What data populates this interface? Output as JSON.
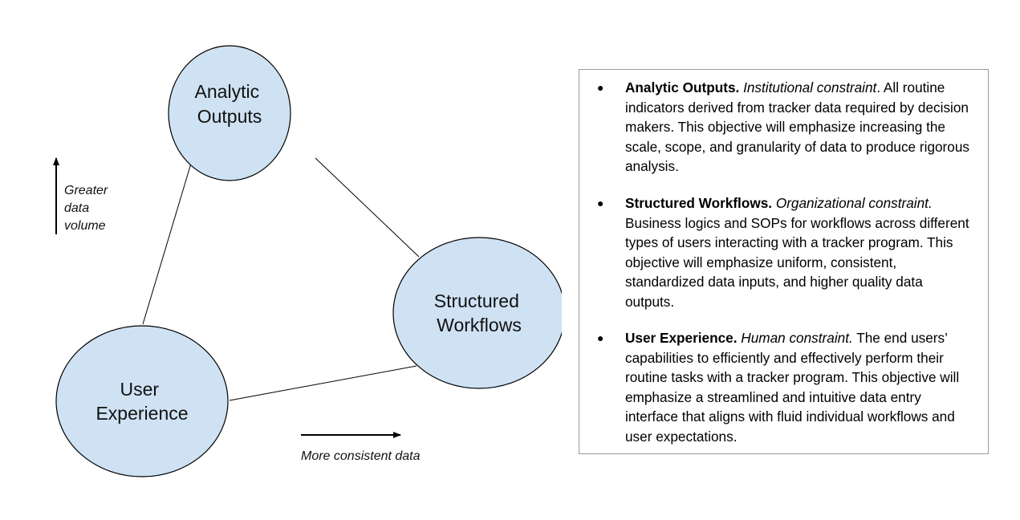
{
  "diagram": {
    "nodes": [
      {
        "id": "analytic-outputs",
        "lines": [
          "Analytic",
          "Outputs"
        ]
      },
      {
        "id": "structured-workflows",
        "lines": [
          "Structured",
          "Workflows"
        ]
      },
      {
        "id": "user-experience",
        "lines": [
          "User",
          "Experience"
        ]
      }
    ],
    "edges": [
      [
        "analytic-outputs",
        "structured-workflows"
      ],
      [
        "analytic-outputs",
        "user-experience"
      ],
      [
        "user-experience",
        "structured-workflows"
      ]
    ],
    "vertical_axis_label": [
      "Greater",
      "data",
      "volume"
    ],
    "horizontal_axis_label": "More consistent data",
    "colors": {
      "node_fill": "#cfe2f3",
      "node_stroke": "#000000",
      "edge": "#000000"
    }
  },
  "legend": {
    "items": [
      {
        "title": "Analytic Outputs.",
        "constraint": "Institutional constraint",
        "description": ". All routine indicators derived from tracker data required by decision makers. This objective will emphasize increasing the scale, scope, and granularity of data to produce rigorous analysis."
      },
      {
        "title": "Structured Workflows.",
        "constraint": "Organizational constraint.",
        "description": "Business logics and SOPs for workflows across different types of users interacting with a tracker program. This objective will emphasize uniform, consistent, standardized data inputs, and higher quality data outputs."
      },
      {
        "title": "User Experience.",
        "constraint": "Human constraint.",
        "description": "The end users’ capabilities to efficiently and effectively perform their routine tasks with a tracker program. This objective will emphasize a streamlined and intuitive data entry interface that aligns with fluid individual workflows and user expectations."
      }
    ]
  }
}
